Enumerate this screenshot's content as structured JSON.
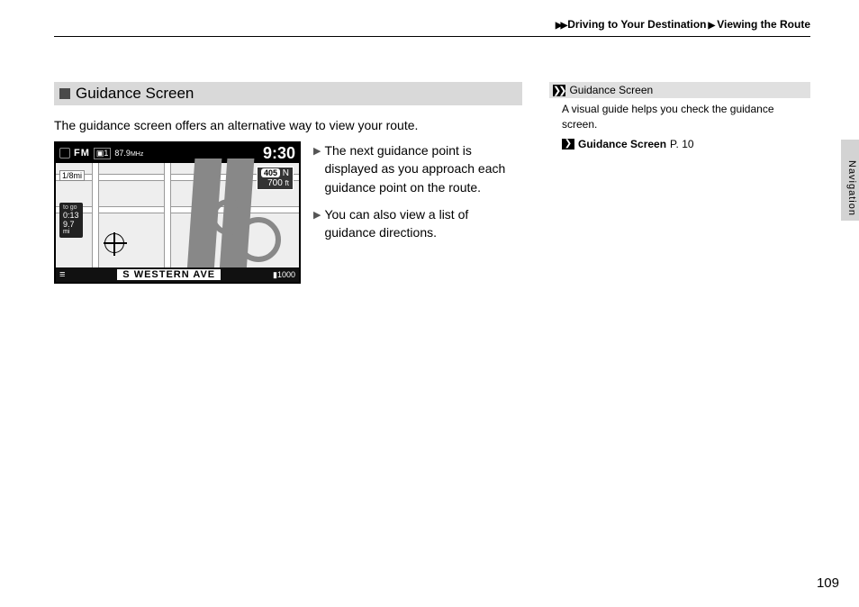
{
  "breadcrumb": {
    "part1": "Driving to Your Destination",
    "part2": "Viewing the Route"
  },
  "section": {
    "title": "Guidance Screen",
    "intro": "The guidance screen offers an alternative way to view your route.",
    "bullets": [
      "The next guidance point is displayed as you approach each guidance point on the route.",
      "You can also view a list of guidance directions."
    ]
  },
  "screenshot": {
    "radio_band": "FM",
    "radio_preset": "1",
    "radio_freq": "87.9",
    "radio_unit": "MHz",
    "clock": "9:30",
    "scale": "1/8mi",
    "highway_shield": "405",
    "highway_dir": "N",
    "sign_distance": "700",
    "sign_unit": "ft",
    "eta_label": "to go",
    "eta_time": "0:13",
    "eta_dist": "9.7",
    "eta_unit": "mi",
    "street": "S WESTERN AVE",
    "bottom_dist": "1000"
  },
  "sidebar": {
    "title": "Guidance Screen",
    "body": "A visual guide helps you check the guidance screen.",
    "link_label": "Guidance Screen",
    "link_page_prefix": "P.",
    "link_page": "10"
  },
  "tab_label": "Navigation",
  "page_number": "109"
}
